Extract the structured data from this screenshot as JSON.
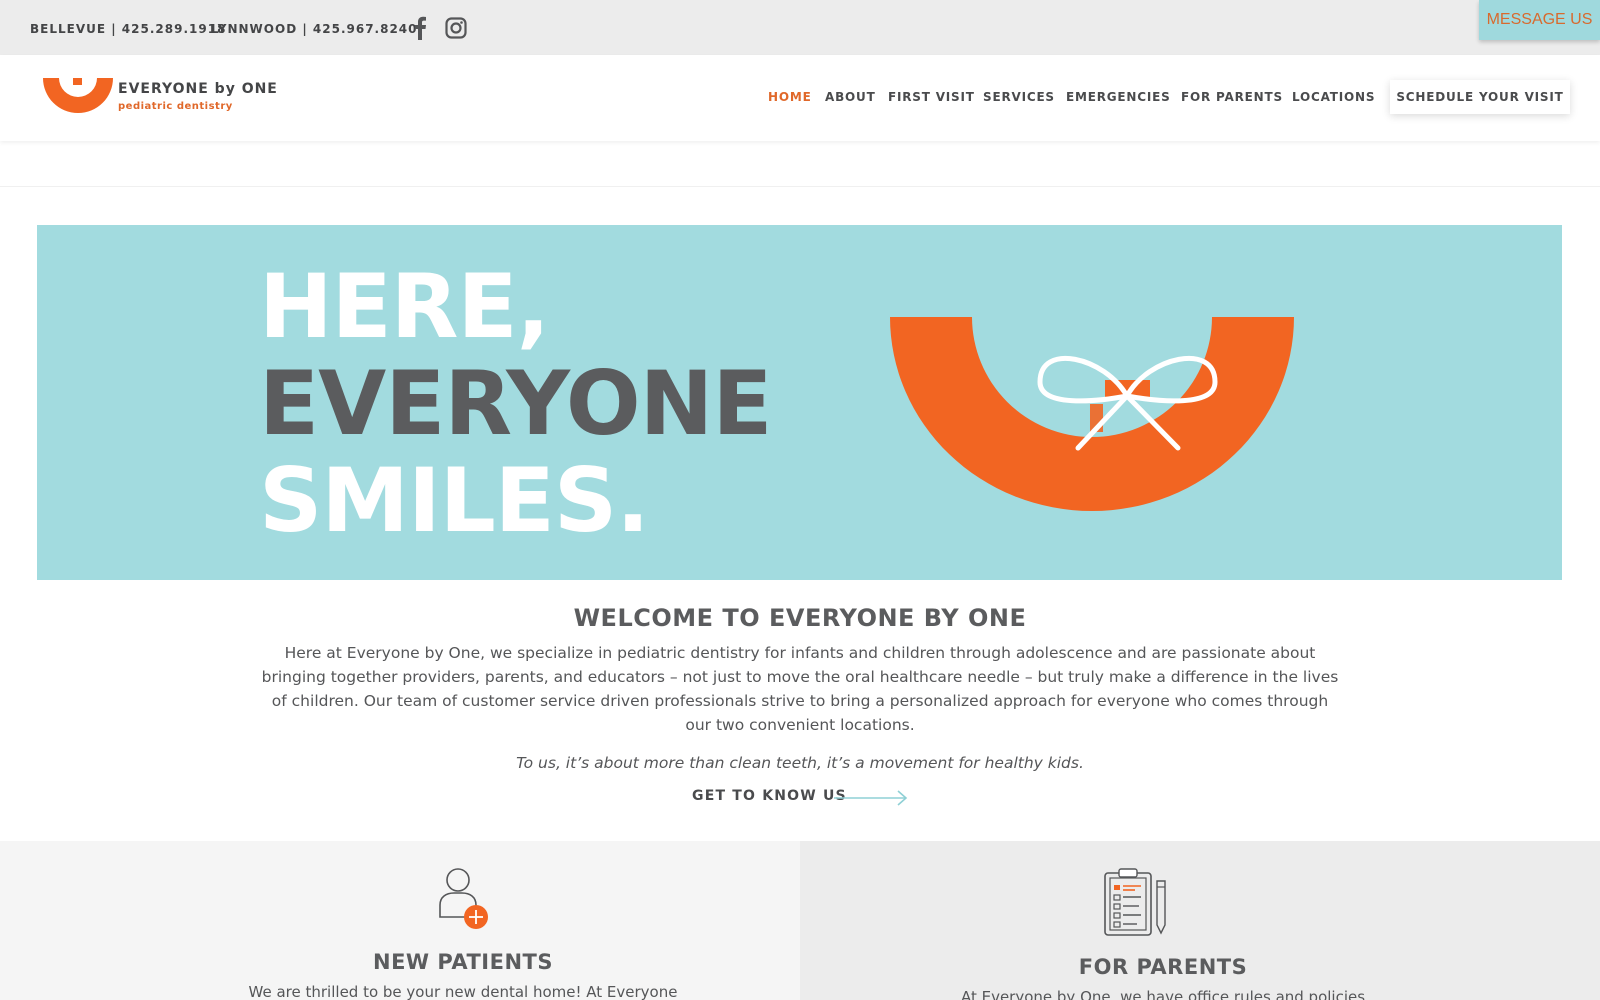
{
  "topbar": {
    "bellevue": "BELLEVUE | 425.289.1918",
    "lynnwood": "LYNNWOOD | 425.967.8240",
    "message_button": "MESSAGE US"
  },
  "logo": {
    "name": "EVERYONE by ONE",
    "tagline": "pediatric dentistry"
  },
  "nav": {
    "items": [
      "HOME",
      "ABOUT",
      "FIRST VISIT",
      "SERVICES",
      "EMERGENCIES",
      "FOR PARENTS",
      "LOCATIONS"
    ],
    "active": "HOME",
    "cta": "SCHEDULE YOUR VISIT"
  },
  "hero": {
    "line1": "HERE,",
    "line2": "EVERYONE",
    "line3": "SMILES."
  },
  "welcome": {
    "title": "WELCOME TO EVERYONE BY ONE",
    "body": "Here at Everyone by One, we specialize in pediatric dentistry for infants and children through adolescence and are passionate about bringing together providers, parents, and educators – not just to move the oral healthcare needle – but truly make a difference in the lives of children. Our team of customer service driven professionals strive to bring a personalized approach for everyone who comes through our two convenient locations.",
    "quote": "To us, it’s about more than clean teeth, it’s a movement for healthy kids.",
    "link": "GET TO KNOW US"
  },
  "cards": [
    {
      "title": "NEW PATIENTS",
      "text": "We are thrilled to be your new dental home! At Everyone"
    },
    {
      "title": "FOR PARENTS",
      "text": "At Everyone by One, we have office rules and policies"
    }
  ],
  "colors": {
    "accent_orange": "#f26522",
    "hero_teal": "#a2dbdf",
    "text_gray": "#5b5c5e"
  }
}
